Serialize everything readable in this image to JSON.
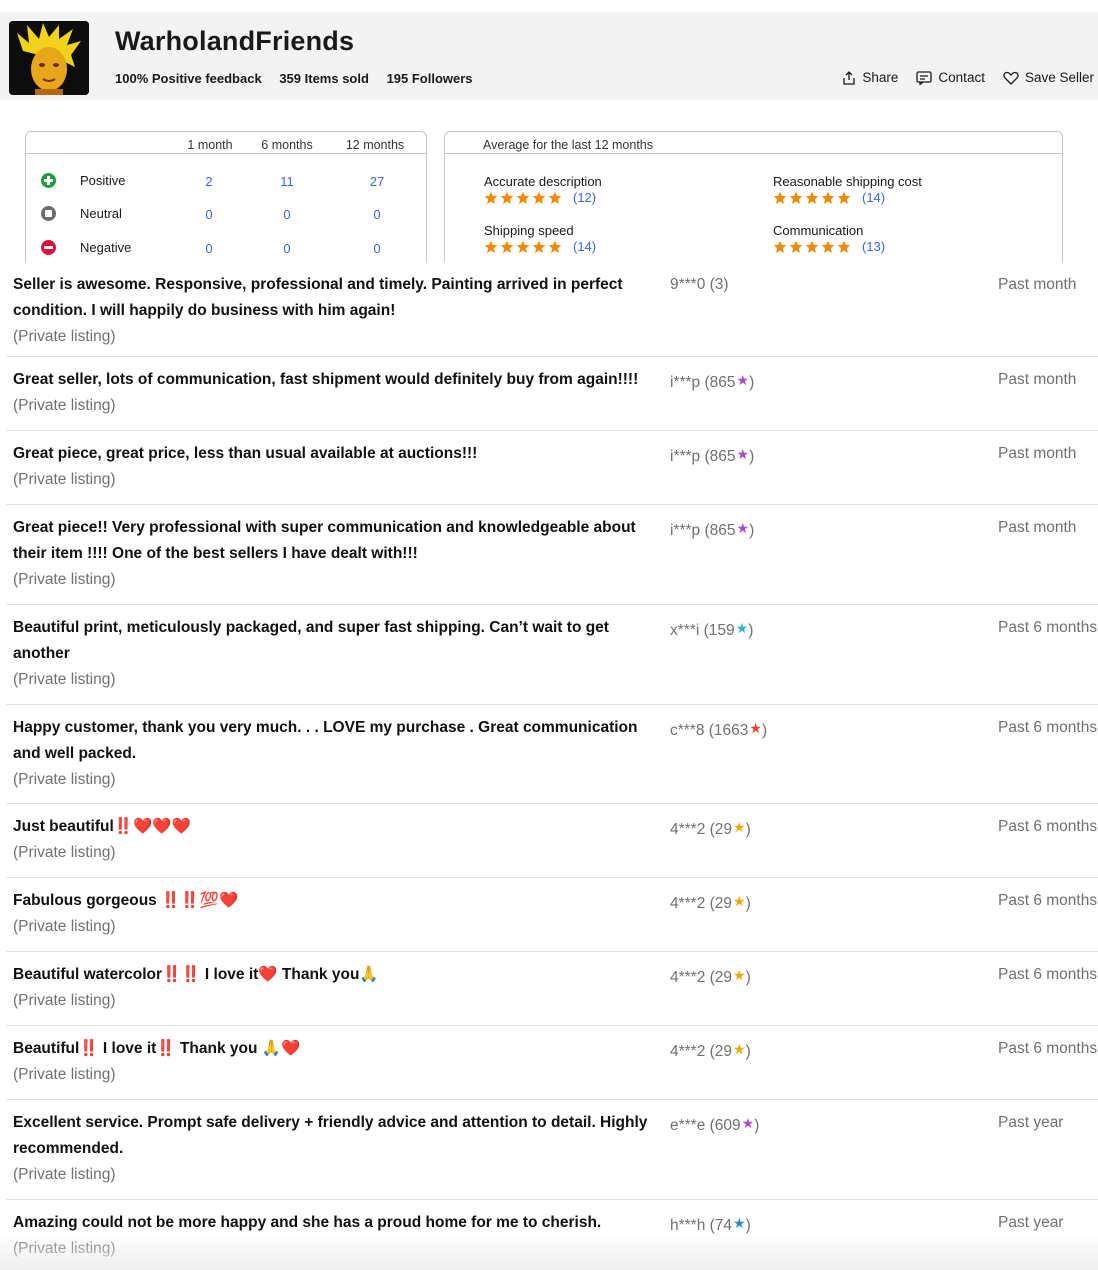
{
  "seller": {
    "name": "WarholandFriends",
    "positive_feedback": "100% Positive feedback",
    "items_sold": "359 Items sold",
    "followers": "195 Followers"
  },
  "actions": {
    "share": "Share",
    "contact": "Contact",
    "save_seller": "Save Seller"
  },
  "ratings": {
    "columns": [
      "1 month",
      "6 months",
      "12 months"
    ],
    "rows": [
      {
        "label": "Positive",
        "icon": "plus-circle-icon",
        "values": [
          "2",
          "11",
          "27"
        ]
      },
      {
        "label": "Neutral",
        "icon": "square-circle-icon",
        "values": [
          "0",
          "0",
          "0"
        ]
      },
      {
        "label": "Negative",
        "icon": "minus-circle-icon",
        "values": [
          "0",
          "0",
          "0"
        ]
      }
    ]
  },
  "detailed": {
    "heading": "Average for the last 12 months",
    "metrics": [
      {
        "label": "Accurate description",
        "count": "(12)",
        "stars": 5
      },
      {
        "label": "Reasonable shipping cost",
        "count": "(14)",
        "stars": 5
      },
      {
        "label": "Shipping speed",
        "count": "(14)",
        "stars": 5
      },
      {
        "label": "Communication",
        "count": "(13)",
        "stars": 5
      }
    ]
  },
  "colors": {
    "link_blue": "#3665f3",
    "star_orange": "#f08a00",
    "positive_green": "#1e9e3e",
    "negative_red": "#e0103a"
  },
  "feedback": [
    {
      "comment": "Seller is awesome. Responsive, professional and timely. Painting arrived in perfect condition. I will happily do business with him again!",
      "listing": "(Private listing)",
      "user": "9***0 (3)",
      "user_suffix": "",
      "star_color": "",
      "when": "Past month"
    },
    {
      "comment": "Great seller, lots of communication, fast shipment would definitely buy from again!!!!",
      "listing": "(Private listing)",
      "user": "i***p (865",
      "user_suffix": ")",
      "star_color": "#b247d6",
      "when": "Past month"
    },
    {
      "comment": "Great piece, great price, less than usual available at auctions!!!",
      "listing": "(Private listing)",
      "user": "i***p (865",
      "user_suffix": ")",
      "star_color": "#b247d6",
      "when": "Past month"
    },
    {
      "comment": "Great piece!! Very professional with super communication and knowledgeable about their item !!!! One of the best sellers I have dealt with!!!",
      "listing": "(Private listing)",
      "user": "i***p (865",
      "user_suffix": ")",
      "star_color": "#b247d6",
      "when": "Past month"
    },
    {
      "comment": "Beautiful print, meticulously packaged, and super fast shipping. Can’t wait to get another",
      "listing": "(Private listing)",
      "user": "x***i (159",
      "user_suffix": ")",
      "star_color": "#29b6d8",
      "when": "Past 6 months"
    },
    {
      "comment": "Happy customer, thank you very much. . . LOVE my purchase . Great communication and well packed.",
      "listing": "(Private listing)",
      "user": "c***8 (1663",
      "user_suffix": ")",
      "star_color": "#e8432e",
      "when": "Past 6 months"
    },
    {
      "comment": "Just beautiful‼️❤️❤️❤️",
      "listing": "(Private listing)",
      "user": "4***2 (29",
      "user_suffix": ")",
      "star_color": "#f2a800",
      "when": "Past 6 months"
    },
    {
      "comment": "Fabulous gorgeous ‼️‼️💯❤️",
      "listing": "(Private listing)",
      "user": "4***2 (29",
      "user_suffix": ")",
      "star_color": "#f2a800",
      "when": "Past 6 months"
    },
    {
      "comment": "Beautiful watercolor‼️‼️ I love it❤️ Thank you🙏",
      "listing": "(Private listing)",
      "user": "4***2 (29",
      "user_suffix": ")",
      "star_color": "#f2a800",
      "when": "Past 6 months"
    },
    {
      "comment": "Beautiful‼️ I love it‼️ Thank you 🙏❤️",
      "listing": "(Private listing)",
      "user": "4***2 (29",
      "user_suffix": ")",
      "star_color": "#f2a800",
      "when": "Past 6 months"
    },
    {
      "comment": "Excellent service. Prompt safe delivery + friendly advice and attention to detail. Highly recommended.",
      "listing": "(Private listing)",
      "user": "e***e (609",
      "user_suffix": ")",
      "star_color": "#b247d6",
      "when": "Past year"
    },
    {
      "comment": "Amazing could not be more happy and she has a proud home for me to cherish.",
      "listing": "(Private listing)",
      "user": "h***h (74",
      "user_suffix": ")",
      "star_color": "#2a8bc9",
      "when": "Past year"
    }
  ]
}
